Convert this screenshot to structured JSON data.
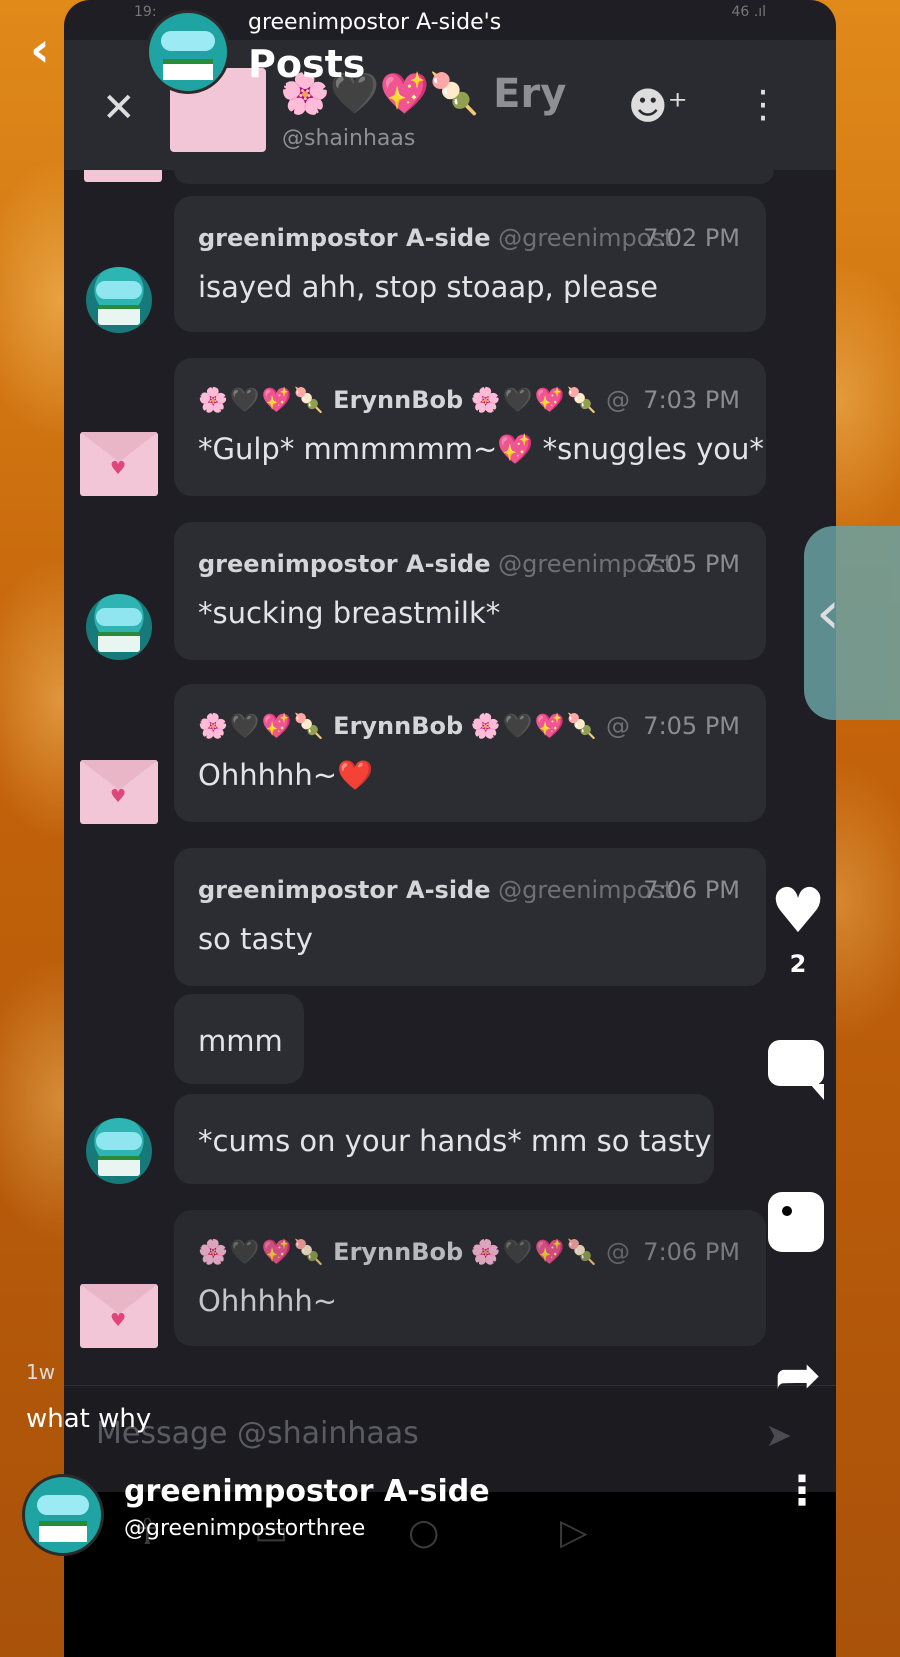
{
  "status": {
    "time": "19:",
    "icons": "46 .ıl"
  },
  "overlay": {
    "back_label": "‹",
    "owner_title": "greenimpostor A-side's",
    "section_title": "Posts",
    "like_count": "2",
    "time_ago": "1w",
    "caption": "what why",
    "author_name": "greenimpostor A-side",
    "author_handle": "@greenimpostorthree",
    "more": "⋮"
  },
  "chat": {
    "close": "✕",
    "partner_name": "🌸🖤💖🍡 Ery",
    "partner_handle": "@shainhaas",
    "add_friend": "☻⁺",
    "menu": "⋮",
    "input_placeholder": "Message @shainhaas",
    "send": "➤"
  },
  "messages": [
    {
      "author": "greenimpostor A-side",
      "handle": "@greenimpost",
      "time": "7:02 PM",
      "text": "isayed ahh, stop stoaap, please"
    },
    {
      "author": "ErynnBob",
      "prefix": "🌸🖤💖🍡",
      "suffix": "🌸🖤💖🍡",
      "handle": "@",
      "time": "7:03 PM",
      "text": "*Gulp* mmmmmm~💖 *snuggles you*"
    },
    {
      "author": "greenimpostor A-side",
      "handle": "@greenimpost",
      "time": "7:05 PM",
      "text": "*sucking breastmilk*"
    },
    {
      "author": "ErynnBob",
      "prefix": "🌸🖤💖🍡",
      "suffix": "🌸🖤💖🍡",
      "handle": "@",
      "time": "7:05 PM",
      "text": "Ohhhhh~❤️"
    },
    {
      "author": "greenimpostor A-side",
      "handle": "@greenimpost",
      "time": "7:06 PM",
      "text": "so tasty"
    },
    {
      "text": "mmm"
    },
    {
      "text": "*cums on your hands* mm so tasty"
    },
    {
      "author": "ErynnBob",
      "prefix": "🌸🖤💖🍡",
      "suffix": "🌸🖤💖🍡",
      "handle": "@",
      "time": "7:06 PM",
      "text": "Ohhhhh~"
    }
  ]
}
